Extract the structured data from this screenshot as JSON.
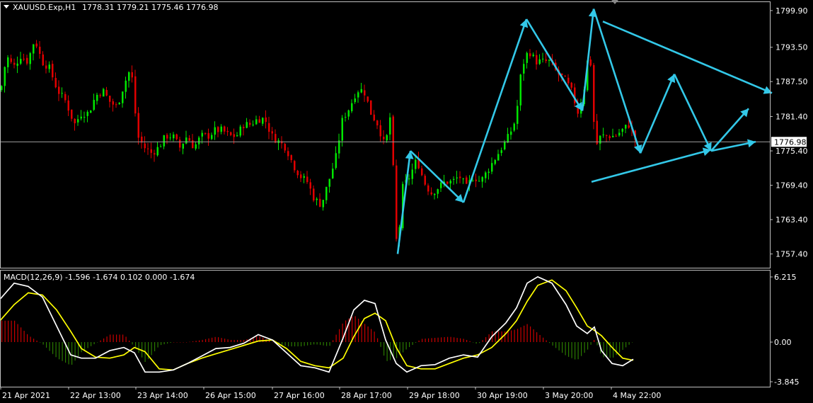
{
  "header": {
    "symbol": "XAUUSD.Exp,H1",
    "ohlc": "1778.31 1779.21 1775.46 1776.98"
  },
  "price_axis": {
    "ticks": [
      "1799.90",
      "1793.50",
      "1787.50",
      "1781.40",
      "1775.40",
      "1769.40",
      "1763.40",
      "1757.40"
    ],
    "current_price": "1776.98"
  },
  "macd": {
    "label": "MACD(12,26,9) -1.596 -1.674 0.102 0.000 -1.674",
    "ticks": [
      "6.215",
      "0.00",
      "-3.845"
    ]
  },
  "time_axis": {
    "ticks": [
      "21 Apr 2021",
      "22 Apr 13:00",
      "23 Apr 14:00",
      "26 Apr 15:00",
      "27 Apr 16:00",
      "28 Apr 17:00",
      "29 Apr 18:00",
      "30 Apr 19:00",
      "3 May 20:00",
      "4 May 22:00"
    ]
  },
  "colors": {
    "background": "#000000",
    "bull": "#00e600",
    "bear": "#e00000",
    "arrows": "#33c8e8",
    "macd_line": "#ffffff",
    "signal_line": "#ffff00",
    "hist_pos": "#c80000",
    "hist_neg": "#2a7a00",
    "grid": "#c0c0c0"
  },
  "chart_data": {
    "type": "candlestick",
    "symbol": "XAUUSD.Exp",
    "timeframe": "H1",
    "ylim": [
      1755.0,
      1801.5
    ],
    "current_price": 1776.98,
    "price_path": [
      [
        0,
        1786
      ],
      [
        8,
        1792
      ],
      [
        18,
        1790
      ],
      [
        28,
        1792
      ],
      [
        38,
        1791
      ],
      [
        48,
        1795
      ],
      [
        58,
        1791
      ],
      [
        68,
        1790
      ],
      [
        80,
        1786
      ],
      [
        92,
        1784
      ],
      [
        104,
        1780
      ],
      [
        114,
        1782
      ],
      [
        124,
        1782
      ],
      [
        134,
        1785
      ],
      [
        144,
        1786
      ],
      [
        154,
        1784
      ],
      [
        164,
        1783
      ],
      [
        174,
        1787
      ],
      [
        184,
        1790
      ],
      [
        193,
        1778
      ],
      [
        203,
        1776
      ],
      [
        213,
        1775
      ],
      [
        223,
        1776
      ],
      [
        233,
        1778
      ],
      [
        243,
        1778
      ],
      [
        253,
        1776
      ],
      [
        263,
        1778
      ],
      [
        273,
        1776
      ],
      [
        283,
        1778
      ],
      [
        293,
        1778
      ],
      [
        303,
        1779
      ],
      [
        313,
        1779
      ],
      [
        323,
        1778
      ],
      [
        333,
        1778
      ],
      [
        343,
        1780
      ],
      [
        353,
        1780
      ],
      [
        363,
        1781
      ],
      [
        373,
        1781
      ],
      [
        383,
        1778
      ],
      [
        393,
        1777
      ],
      [
        403,
        1776
      ],
      [
        413,
        1773
      ],
      [
        423,
        1771
      ],
      [
        433,
        1770
      ],
      [
        443,
        1767
      ],
      [
        453,
        1766
      ],
      [
        463,
        1770
      ],
      [
        473,
        1774
      ],
      [
        483,
        1781
      ],
      [
        493,
        1783
      ],
      [
        503,
        1786
      ],
      [
        513,
        1786
      ],
      [
        523,
        1782
      ],
      [
        533,
        1780
      ],
      [
        543,
        1776
      ],
      [
        551,
        1782
      ],
      [
        560,
        1757
      ],
      [
        568,
        1769
      ],
      [
        578,
        1771
      ],
      [
        588,
        1774
      ],
      [
        598,
        1770
      ],
      [
        608,
        1768
      ],
      [
        618,
        1769
      ],
      [
        628,
        1770
      ],
      [
        638,
        1770
      ],
      [
        648,
        1771
      ],
      [
        658,
        1769
      ],
      [
        668,
        1771
      ],
      [
        678,
        1770
      ],
      [
        688,
        1772
      ],
      [
        698,
        1774
      ],
      [
        708,
        1776
      ],
      [
        718,
        1778
      ],
      [
        728,
        1781
      ],
      [
        736,
        1790
      ],
      [
        746,
        1793
      ],
      [
        756,
        1791
      ],
      [
        766,
        1791
      ],
      [
        776,
        1791
      ],
      [
        786,
        1789
      ],
      [
        796,
        1788
      ],
      [
        806,
        1786
      ],
      [
        816,
        1782
      ],
      [
        824,
        1786
      ],
      [
        832,
        1794
      ],
      [
        840,
        1776
      ],
      [
        848,
        1778
      ],
      [
        858,
        1778
      ],
      [
        868,
        1778
      ],
      [
        878,
        1779
      ],
      [
        888,
        1780
      ],
      [
        898,
        1777
      ]
    ],
    "macd_line": [
      [
        0,
        4.0
      ],
      [
        20,
        5.5
      ],
      [
        40,
        5.2
      ],
      [
        60,
        4.2
      ],
      [
        80,
        1.5
      ],
      [
        100,
        -1.2
      ],
      [
        115,
        -1.5
      ],
      [
        135,
        -1.5
      ],
      [
        155,
        -0.8
      ],
      [
        175,
        -0.5
      ],
      [
        190,
        -1.0
      ],
      [
        205,
        -2.8
      ],
      [
        225,
        -2.8
      ],
      [
        245,
        -2.6
      ],
      [
        265,
        -2.0
      ],
      [
        285,
        -1.3
      ],
      [
        305,
        -0.6
      ],
      [
        325,
        -0.5
      ],
      [
        345,
        -0.1
      ],
      [
        365,
        0.7
      ],
      [
        385,
        0.2
      ],
      [
        405,
        -1.0
      ],
      [
        425,
        -2.2
      ],
      [
        445,
        -2.4
      ],
      [
        465,
        -2.8
      ],
      [
        485,
        0.4
      ],
      [
        500,
        3.0
      ],
      [
        515,
        3.9
      ],
      [
        530,
        3.6
      ],
      [
        545,
        0.2
      ],
      [
        560,
        -2.0
      ],
      [
        575,
        -2.8
      ],
      [
        595,
        -2.2
      ],
      [
        615,
        -2.1
      ],
      [
        635,
        -1.5
      ],
      [
        655,
        -1.2
      ],
      [
        675,
        -1.4
      ],
      [
        695,
        0.5
      ],
      [
        715,
        1.8
      ],
      [
        730,
        3.2
      ],
      [
        745,
        5.5
      ],
      [
        760,
        6.1
      ],
      [
        780,
        5.5
      ],
      [
        800,
        3.5
      ],
      [
        815,
        1.5
      ],
      [
        830,
        0.8
      ],
      [
        840,
        1.4
      ],
      [
        850,
        -0.8
      ],
      [
        865,
        -2.0
      ],
      [
        880,
        -2.2
      ],
      [
        895,
        -1.6
      ]
    ],
    "signal_line": [
      [
        0,
        2.0
      ],
      [
        20,
        3.5
      ],
      [
        40,
        4.6
      ],
      [
        60,
        4.4
      ],
      [
        80,
        3.0
      ],
      [
        100,
        1.0
      ],
      [
        115,
        -0.6
      ],
      [
        135,
        -1.4
      ],
      [
        155,
        -1.5
      ],
      [
        175,
        -1.2
      ],
      [
        190,
        -0.5
      ],
      [
        205,
        -0.9
      ],
      [
        225,
        -2.5
      ],
      [
        245,
        -2.6
      ],
      [
        265,
        -2.0
      ],
      [
        285,
        -1.5
      ],
      [
        305,
        -1.1
      ],
      [
        325,
        -0.7
      ],
      [
        345,
        -0.3
      ],
      [
        365,
        0.1
      ],
      [
        385,
        0.2
      ],
      [
        405,
        -0.6
      ],
      [
        425,
        -1.8
      ],
      [
        445,
        -2.2
      ],
      [
        465,
        -2.4
      ],
      [
        485,
        -1.5
      ],
      [
        500,
        0.5
      ],
      [
        515,
        2.2
      ],
      [
        530,
        2.7
      ],
      [
        545,
        2.0
      ],
      [
        560,
        -0.5
      ],
      [
        575,
        -2.2
      ],
      [
        595,
        -2.5
      ],
      [
        615,
        -2.5
      ],
      [
        635,
        -2.0
      ],
      [
        655,
        -1.5
      ],
      [
        675,
        -1.2
      ],
      [
        695,
        -0.5
      ],
      [
        715,
        0.8
      ],
      [
        730,
        2.0
      ],
      [
        745,
        3.8
      ],
      [
        760,
        5.3
      ],
      [
        780,
        5.8
      ],
      [
        800,
        4.8
      ],
      [
        815,
        3.2
      ],
      [
        830,
        1.5
      ],
      [
        840,
        1.1
      ],
      [
        850,
        0.6
      ],
      [
        865,
        -0.5
      ],
      [
        880,
        -1.5
      ],
      [
        895,
        -1.7
      ]
    ],
    "annotation_arrows": [
      [
        [
          562,
          1757.4
        ],
        [
          580,
          1775.4
        ]
      ],
      [
        [
          580,
          1775.4
        ],
        [
          655,
          1766.4
        ]
      ],
      [
        [
          655,
          1766.4
        ],
        [
          744,
          1798.4
        ]
      ],
      [
        [
          744,
          1798.4
        ],
        [
          823,
          1782.4
        ]
      ],
      [
        [
          823,
          1782.4
        ],
        [
          839,
          1800.2
        ]
      ],
      [
        [
          839,
          1800.2
        ],
        [
          905,
          1775.0
        ]
      ],
      [
        [
          905,
          1775.0
        ],
        [
          953,
          1788.8
        ]
      ],
      [
        [
          953,
          1788.8
        ],
        [
          1005,
          1775.4
        ]
      ],
      [
        [
          1005,
          1775.4
        ],
        [
          1058,
          1782.8
        ]
      ],
      [
        [
          1005,
          1775.4
        ],
        [
          1068,
          1777.0
        ]
      ],
      [
        [
          852,
          1798.0
        ],
        [
          1091,
          1785.5
        ]
      ],
      [
        [
          836,
          1770.0
        ],
        [
          1005,
          1775.6
        ]
      ]
    ]
  }
}
